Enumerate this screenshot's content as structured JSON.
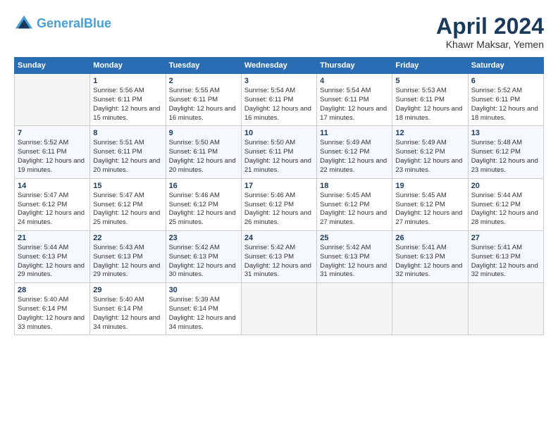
{
  "logo": {
    "line1": "General",
    "line2": "Blue"
  },
  "title": "April 2024",
  "subtitle": "Khawr Maksar, Yemen",
  "columns": [
    "Sunday",
    "Monday",
    "Tuesday",
    "Wednesday",
    "Thursday",
    "Friday",
    "Saturday"
  ],
  "weeks": [
    [
      {
        "num": "",
        "sunrise": "",
        "sunset": "",
        "daylight": ""
      },
      {
        "num": "1",
        "sunrise": "Sunrise: 5:56 AM",
        "sunset": "Sunset: 6:11 PM",
        "daylight": "Daylight: 12 hours and 15 minutes."
      },
      {
        "num": "2",
        "sunrise": "Sunrise: 5:55 AM",
        "sunset": "Sunset: 6:11 PM",
        "daylight": "Daylight: 12 hours and 16 minutes."
      },
      {
        "num": "3",
        "sunrise": "Sunrise: 5:54 AM",
        "sunset": "Sunset: 6:11 PM",
        "daylight": "Daylight: 12 hours and 16 minutes."
      },
      {
        "num": "4",
        "sunrise": "Sunrise: 5:54 AM",
        "sunset": "Sunset: 6:11 PM",
        "daylight": "Daylight: 12 hours and 17 minutes."
      },
      {
        "num": "5",
        "sunrise": "Sunrise: 5:53 AM",
        "sunset": "Sunset: 6:11 PM",
        "daylight": "Daylight: 12 hours and 18 minutes."
      },
      {
        "num": "6",
        "sunrise": "Sunrise: 5:52 AM",
        "sunset": "Sunset: 6:11 PM",
        "daylight": "Daylight: 12 hours and 18 minutes."
      }
    ],
    [
      {
        "num": "7",
        "sunrise": "Sunrise: 5:52 AM",
        "sunset": "Sunset: 6:11 PM",
        "daylight": "Daylight: 12 hours and 19 minutes."
      },
      {
        "num": "8",
        "sunrise": "Sunrise: 5:51 AM",
        "sunset": "Sunset: 6:11 PM",
        "daylight": "Daylight: 12 hours and 20 minutes."
      },
      {
        "num": "9",
        "sunrise": "Sunrise: 5:50 AM",
        "sunset": "Sunset: 6:11 PM",
        "daylight": "Daylight: 12 hours and 20 minutes."
      },
      {
        "num": "10",
        "sunrise": "Sunrise: 5:50 AM",
        "sunset": "Sunset: 6:11 PM",
        "daylight": "Daylight: 12 hours and 21 minutes."
      },
      {
        "num": "11",
        "sunrise": "Sunrise: 5:49 AM",
        "sunset": "Sunset: 6:12 PM",
        "daylight": "Daylight: 12 hours and 22 minutes."
      },
      {
        "num": "12",
        "sunrise": "Sunrise: 5:49 AM",
        "sunset": "Sunset: 6:12 PM",
        "daylight": "Daylight: 12 hours and 23 minutes."
      },
      {
        "num": "13",
        "sunrise": "Sunrise: 5:48 AM",
        "sunset": "Sunset: 6:12 PM",
        "daylight": "Daylight: 12 hours and 23 minutes."
      }
    ],
    [
      {
        "num": "14",
        "sunrise": "Sunrise: 5:47 AM",
        "sunset": "Sunset: 6:12 PM",
        "daylight": "Daylight: 12 hours and 24 minutes."
      },
      {
        "num": "15",
        "sunrise": "Sunrise: 5:47 AM",
        "sunset": "Sunset: 6:12 PM",
        "daylight": "Daylight: 12 hours and 25 minutes."
      },
      {
        "num": "16",
        "sunrise": "Sunrise: 5:46 AM",
        "sunset": "Sunset: 6:12 PM",
        "daylight": "Daylight: 12 hours and 25 minutes."
      },
      {
        "num": "17",
        "sunrise": "Sunrise: 5:46 AM",
        "sunset": "Sunset: 6:12 PM",
        "daylight": "Daylight: 12 hours and 26 minutes."
      },
      {
        "num": "18",
        "sunrise": "Sunrise: 5:45 AM",
        "sunset": "Sunset: 6:12 PM",
        "daylight": "Daylight: 12 hours and 27 minutes."
      },
      {
        "num": "19",
        "sunrise": "Sunrise: 5:45 AM",
        "sunset": "Sunset: 6:12 PM",
        "daylight": "Daylight: 12 hours and 27 minutes."
      },
      {
        "num": "20",
        "sunrise": "Sunrise: 5:44 AM",
        "sunset": "Sunset: 6:12 PM",
        "daylight": "Daylight: 12 hours and 28 minutes."
      }
    ],
    [
      {
        "num": "21",
        "sunrise": "Sunrise: 5:44 AM",
        "sunset": "Sunset: 6:13 PM",
        "daylight": "Daylight: 12 hours and 29 minutes."
      },
      {
        "num": "22",
        "sunrise": "Sunrise: 5:43 AM",
        "sunset": "Sunset: 6:13 PM",
        "daylight": "Daylight: 12 hours and 29 minutes."
      },
      {
        "num": "23",
        "sunrise": "Sunrise: 5:42 AM",
        "sunset": "Sunset: 6:13 PM",
        "daylight": "Daylight: 12 hours and 30 minutes."
      },
      {
        "num": "24",
        "sunrise": "Sunrise: 5:42 AM",
        "sunset": "Sunset: 6:13 PM",
        "daylight": "Daylight: 12 hours and 31 minutes."
      },
      {
        "num": "25",
        "sunrise": "Sunrise: 5:42 AM",
        "sunset": "Sunset: 6:13 PM",
        "daylight": "Daylight: 12 hours and 31 minutes."
      },
      {
        "num": "26",
        "sunrise": "Sunrise: 5:41 AM",
        "sunset": "Sunset: 6:13 PM",
        "daylight": "Daylight: 12 hours and 32 minutes."
      },
      {
        "num": "27",
        "sunrise": "Sunrise: 5:41 AM",
        "sunset": "Sunset: 6:13 PM",
        "daylight": "Daylight: 12 hours and 32 minutes."
      }
    ],
    [
      {
        "num": "28",
        "sunrise": "Sunrise: 5:40 AM",
        "sunset": "Sunset: 6:14 PM",
        "daylight": "Daylight: 12 hours and 33 minutes."
      },
      {
        "num": "29",
        "sunrise": "Sunrise: 5:40 AM",
        "sunset": "Sunset: 6:14 PM",
        "daylight": "Daylight: 12 hours and 34 minutes."
      },
      {
        "num": "30",
        "sunrise": "Sunrise: 5:39 AM",
        "sunset": "Sunset: 6:14 PM",
        "daylight": "Daylight: 12 hours and 34 minutes."
      },
      {
        "num": "",
        "sunrise": "",
        "sunset": "",
        "daylight": ""
      },
      {
        "num": "",
        "sunrise": "",
        "sunset": "",
        "daylight": ""
      },
      {
        "num": "",
        "sunrise": "",
        "sunset": "",
        "daylight": ""
      },
      {
        "num": "",
        "sunrise": "",
        "sunset": "",
        "daylight": ""
      }
    ]
  ]
}
